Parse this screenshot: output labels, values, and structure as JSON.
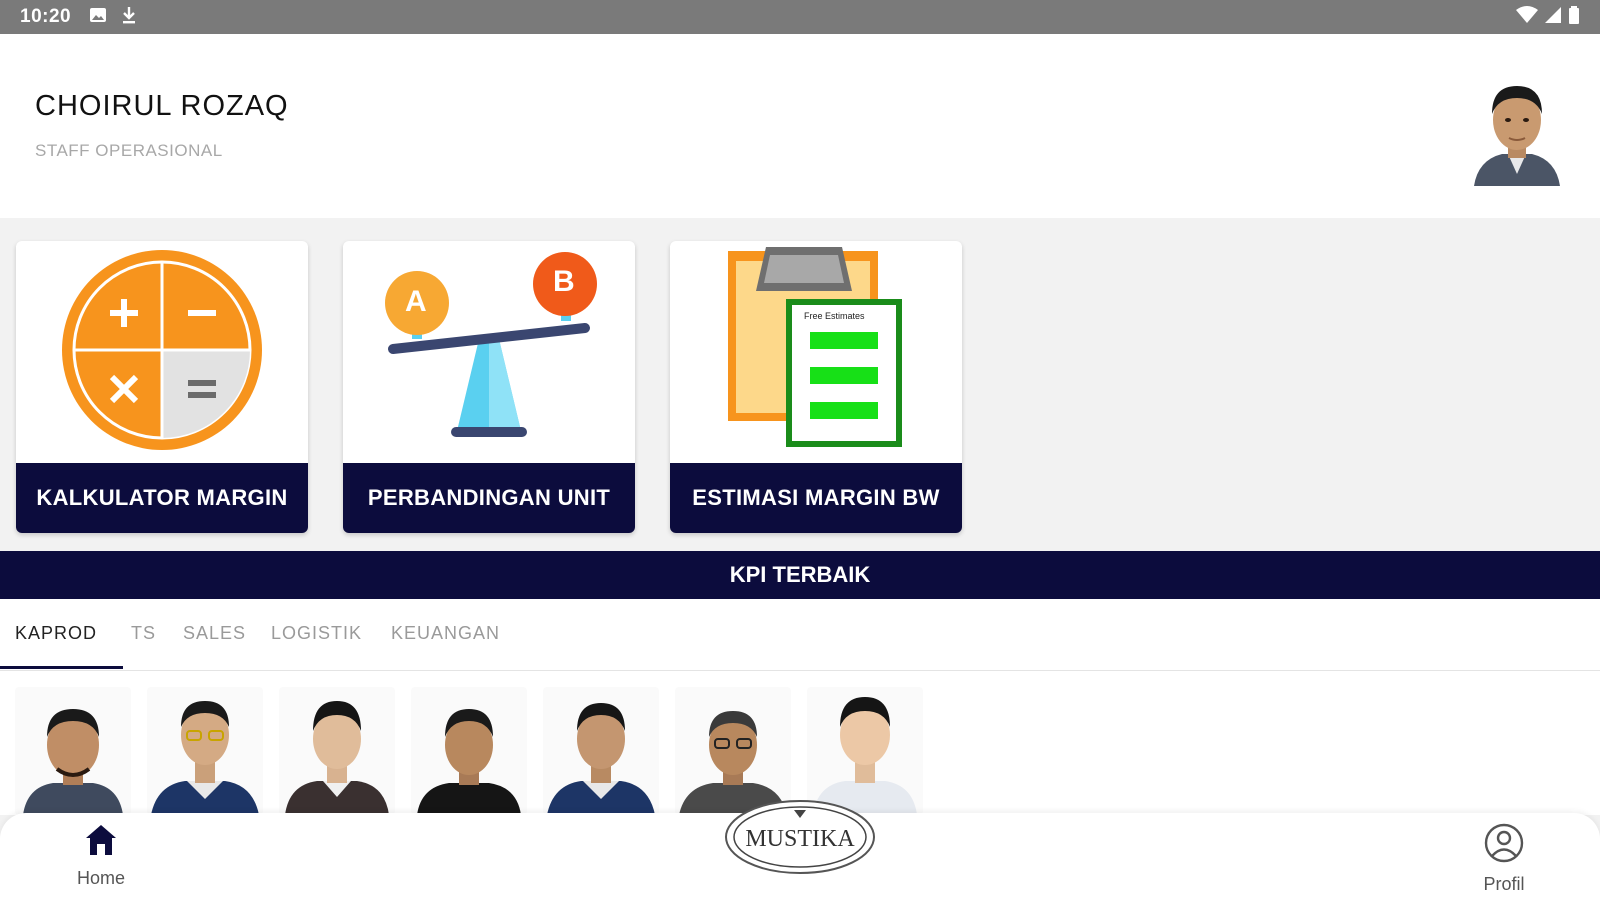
{
  "status_bar": {
    "time": "10:20"
  },
  "header": {
    "name": "CHOIRUL ROZAQ",
    "role": "STAFF OPERASIONAL"
  },
  "menu_cards": [
    {
      "label": "KALKULATOR MARGIN",
      "icon": "calculator-icon"
    },
    {
      "label": "PERBANDINGAN UNIT",
      "icon": "scale-compare-icon",
      "left_badge": "A",
      "right_badge": "B"
    },
    {
      "label": "ESTIMASI MARGIN BW",
      "icon": "clipboard-estimate-icon",
      "sheet_title": "Free Estimates"
    }
  ],
  "kpi": {
    "title": "KPI TERBAIK"
  },
  "tabs": [
    {
      "label": "KAPROD",
      "active": true
    },
    {
      "label": "TS",
      "active": false
    },
    {
      "label": "SALES",
      "active": false
    },
    {
      "label": "LOGISTIK",
      "active": false
    },
    {
      "label": "KEUANGAN",
      "active": false
    }
  ],
  "bottom_nav": {
    "home_label": "Home",
    "profile_label": "Profil",
    "logo_text": "MUSTIKA"
  },
  "colors": {
    "navy": "#0c0c3d",
    "orange": "#f7941d",
    "green": "#17e017"
  }
}
